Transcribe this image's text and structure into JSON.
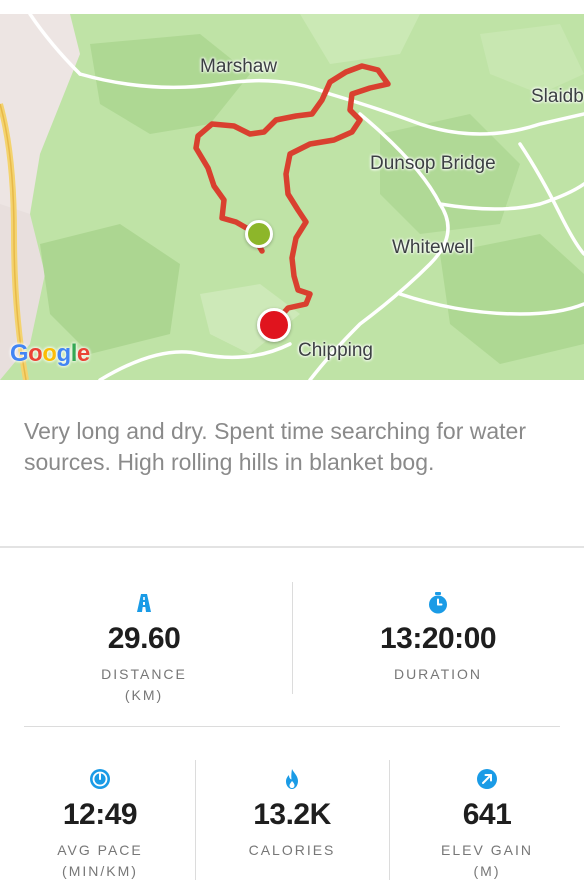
{
  "map": {
    "places": [
      "Marshaw",
      "Slaidb",
      "Dunsop Bridge",
      "Whitewell",
      "Chipping"
    ],
    "logo": "Google",
    "route_color": "#d9402f",
    "start_marker_color": "#8db62a",
    "end_marker_color": "#e0141e"
  },
  "notes": "Very long and dry. Spent time searching for water sources. High rolling hills in blanket bog.",
  "stats": {
    "distance": {
      "value": "29.60",
      "label": "DISTANCE",
      "unit": "(KM)",
      "icon": "road-icon"
    },
    "duration": {
      "value": "13:20:00",
      "label": "DURATION",
      "icon": "stopwatch-icon"
    },
    "avg_pace": {
      "value": "12:49",
      "label": "AVG PACE",
      "unit": "(MIN/KM)",
      "icon": "speedometer-icon"
    },
    "calories": {
      "value": "13.2K",
      "label": "CALORIES",
      "icon": "flame-icon"
    },
    "elev_gain": {
      "value": "641",
      "label": "ELEV GAIN",
      "unit": "(M)",
      "icon": "arrow-up-right-icon"
    }
  },
  "colors": {
    "accent": "#1a9be6",
    "text_muted": "#8a8a8a"
  }
}
